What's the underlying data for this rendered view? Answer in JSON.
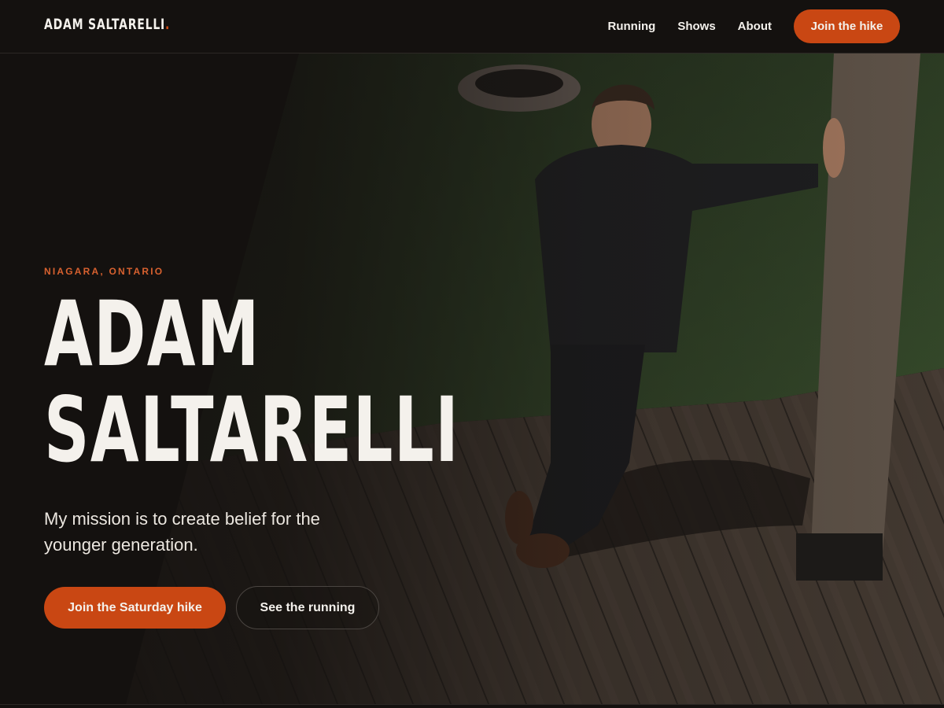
{
  "header": {
    "logo_text": "ADAM SALTARELLI",
    "logo_dot": ".",
    "nav": [
      {
        "label": "Running"
      },
      {
        "label": "Shows"
      },
      {
        "label": "About"
      }
    ],
    "cta_label": "Join the hike"
  },
  "hero": {
    "eyebrow": "NIAGARA, ONTARIO",
    "title_line1": "ADAM",
    "title_line2": "SALTARELLI",
    "tagline": "My mission is to create belief for the younger generation.",
    "primary_button": "Join the Saturday hike",
    "secondary_button": "See the running"
  },
  "colors": {
    "accent": "#c94713",
    "background": "#14110f",
    "text": "#f4f1ec"
  }
}
